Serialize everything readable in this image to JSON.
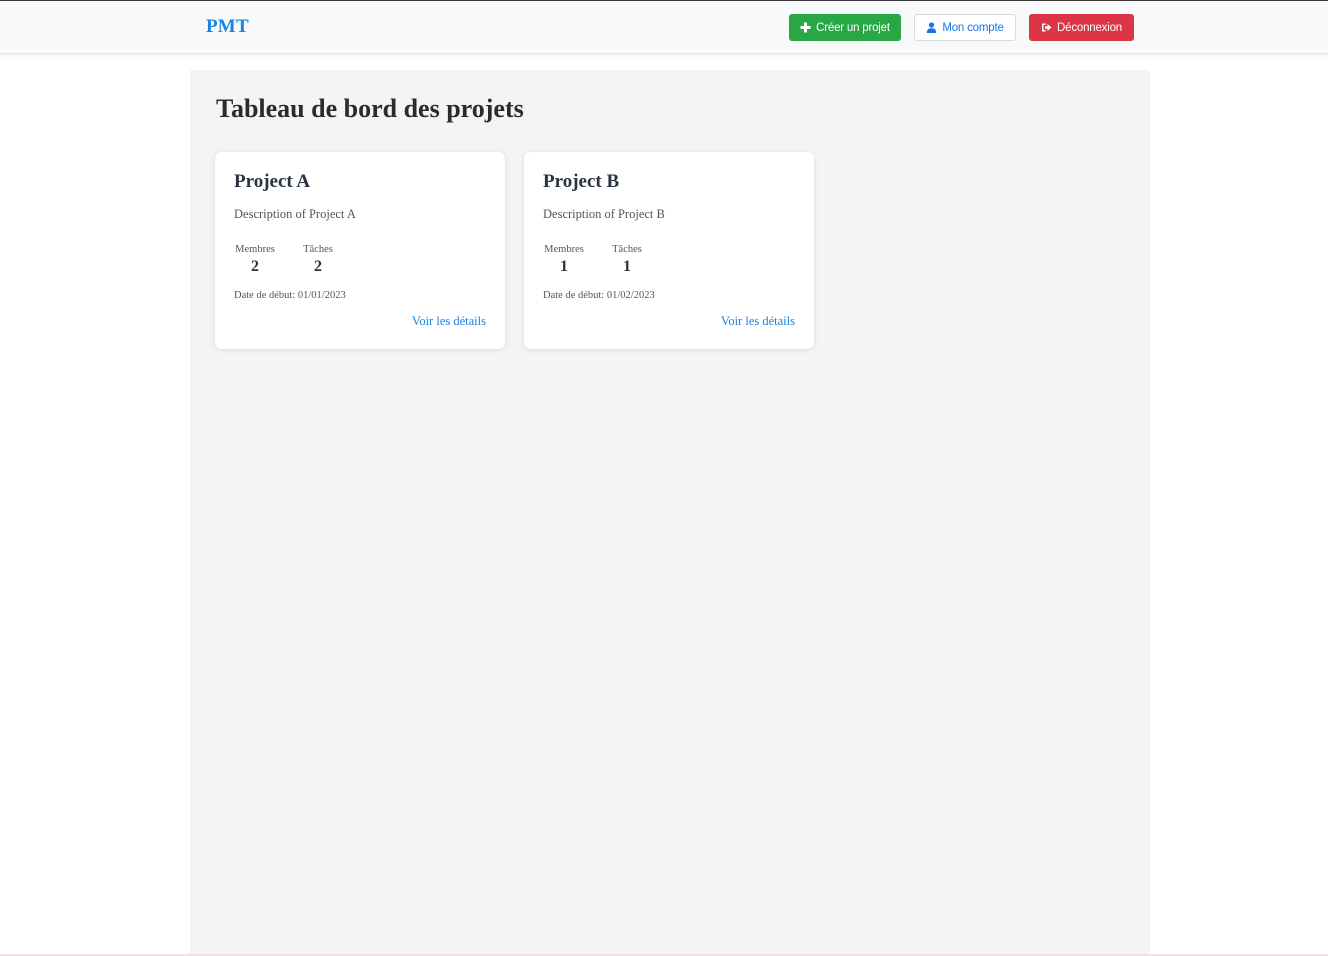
{
  "navbar": {
    "brand": "PMT",
    "buttons": {
      "create_label": "Créer un projet",
      "account_label": "Mon compte",
      "logout_label": "Déconnexion"
    },
    "icons": {
      "create": "plus-icon",
      "account": "user-icon",
      "logout": "sign-out-icon"
    }
  },
  "main": {
    "title": "Tableau de bord des projets"
  },
  "projects": [
    {
      "name": "Project A",
      "description": "Description of Project A",
      "members_label": "Membres",
      "members_count": "2",
      "tasks_label": "Tâches",
      "tasks_count": "2",
      "start_date_label": "Date de début:",
      "start_date": "01/01/2023",
      "details_link": "Voir les détails"
    },
    {
      "name": "Project B",
      "description": "Description of Project B",
      "members_label": "Membres",
      "members_count": "1",
      "tasks_label": "Tâches",
      "tasks_count": "1",
      "start_date_label": "Date de début:",
      "start_date": "01/02/2023",
      "details_link": "Voir les détails"
    }
  ],
  "colors": {
    "brand": "#1a82e2",
    "success": "#28a745",
    "danger": "#dc3545",
    "link": "#1a82e2",
    "page_background": "#f4f4f4"
  }
}
